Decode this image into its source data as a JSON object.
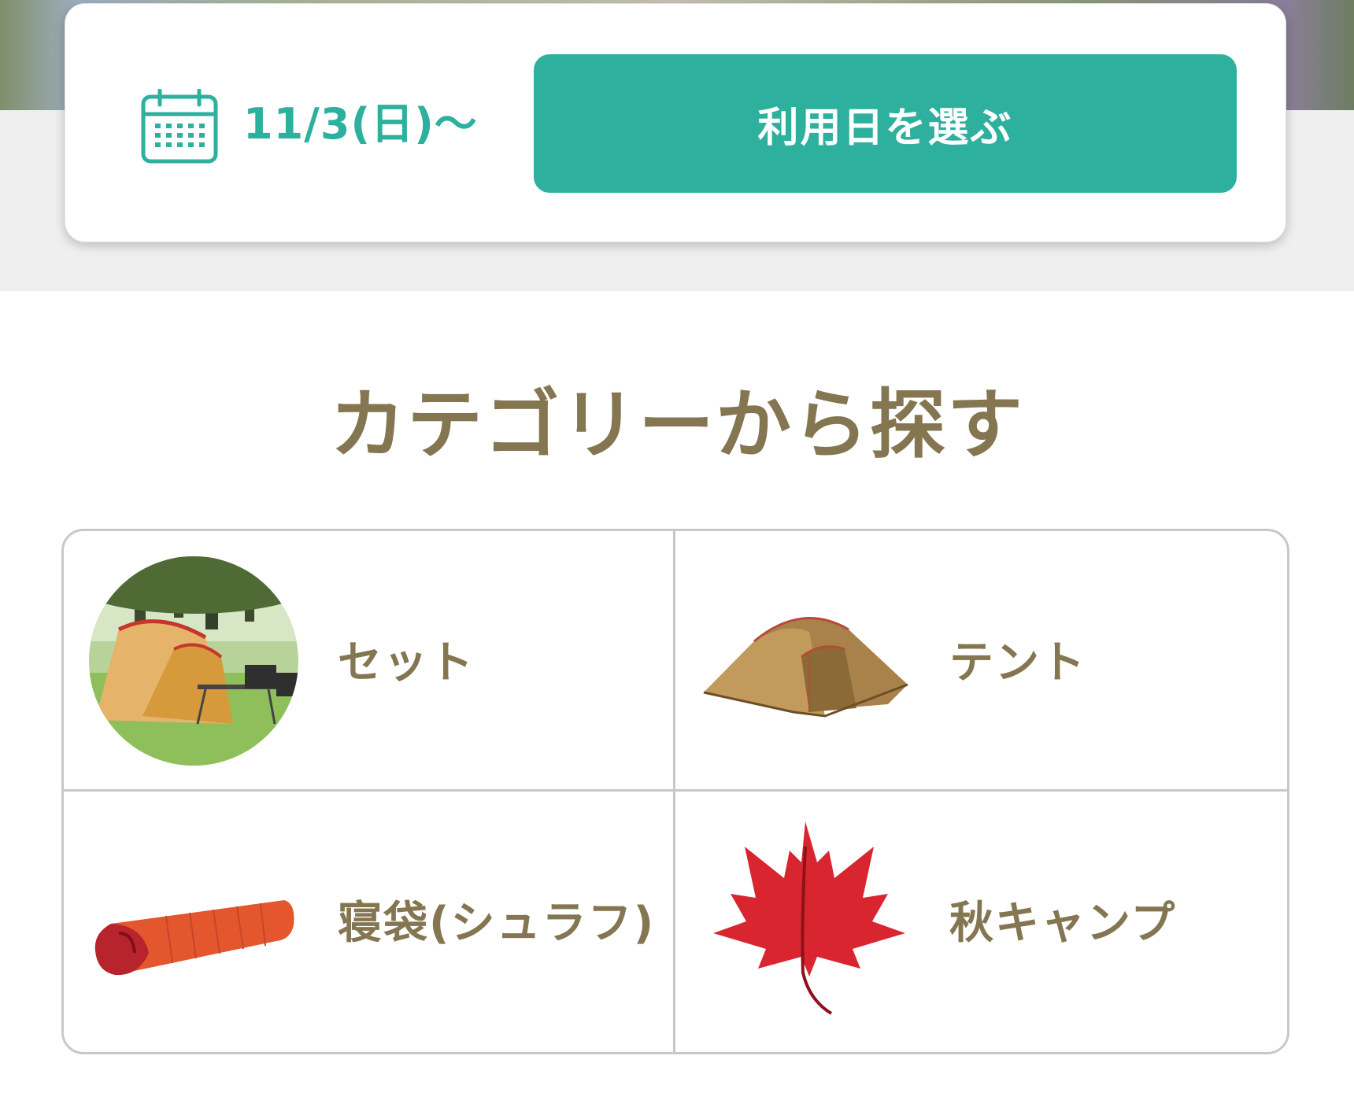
{
  "date_bar": {
    "date": "11/3(日)〜",
    "select_button": "利用日を選ぶ",
    "accent_color": "#2db09d",
    "calendar_icon": "calendar-icon"
  },
  "categories_section": {
    "title": "カテゴリーから探す",
    "items": [
      {
        "label": "セット",
        "icon": "camp-set-photo"
      },
      {
        "label": "テント",
        "icon": "tent-photo"
      },
      {
        "label": "寝袋(シュラフ)",
        "icon": "sleeping-bag-photo"
      },
      {
        "label": "秋キャンプ",
        "icon": "maple-leaf-icon"
      }
    ]
  }
}
